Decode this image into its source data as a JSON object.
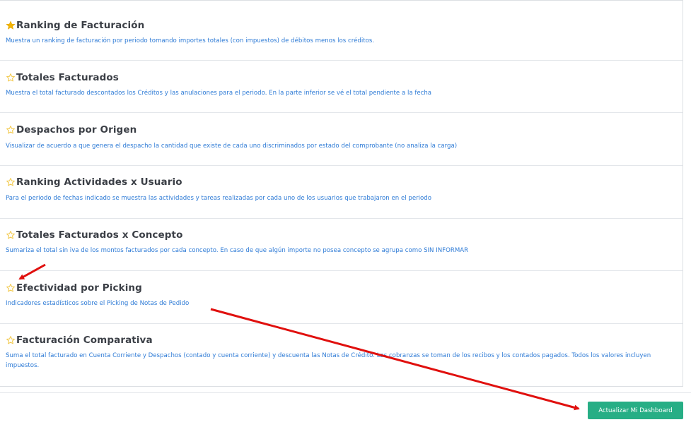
{
  "colors": {
    "accent_button": "#27ae85",
    "description_text": "#2e7bd6",
    "star_filled": "#f4b400",
    "star_outline": "#f2c94c",
    "annotation_arrow": "#e0100e"
  },
  "reports": [
    {
      "title": "Ranking de Facturación",
      "description": "Muestra un ranking de facturación por periodo tomando importes totales (con impuestos) de débitos menos los créditos.",
      "starred": true
    },
    {
      "title": "Totales Facturados",
      "description": "Muestra el total facturado descontados los Créditos y las anulaciones para el periodo. En la parte inferior se vé el total pendiente a la fecha",
      "starred": false
    },
    {
      "title": "Despachos por Origen",
      "description": "Visualizar de acuerdo a que genera el despacho la cantidad que existe de cada uno discriminados por estado del comprobante (no analiza la carga)",
      "starred": false
    },
    {
      "title": "Ranking Actividades x Usuario",
      "description": "Para el periodo de fechas indicado se muestra las actividades y tareas realizadas por cada uno de los usuarios que trabajaron en el periodo",
      "starred": false
    },
    {
      "title": "Totales Facturados x Concepto",
      "description": "Sumariza el total sin iva de los montos facturados por cada concepto. En caso de que algún importe no posea concepto se agrupa como SIN INFORMAR",
      "starred": false
    },
    {
      "title": "Efectividad por Picking",
      "description": "Indicadores estadísticos sobre el Picking de Notas de Pedido",
      "starred": false
    },
    {
      "title": "Facturación Comparativa",
      "description": "Suma el total facturado en Cuenta Corriente y Despachos (contado y cuenta corriente) y descuenta las Notas de Crédito. Las cobranzas se toman de los recibos y los contados pagados. Todos los valores incluyen impuestos.",
      "starred": false
    }
  ],
  "footer": {
    "update_button_label": "Actualizar Mi Dashboard"
  }
}
